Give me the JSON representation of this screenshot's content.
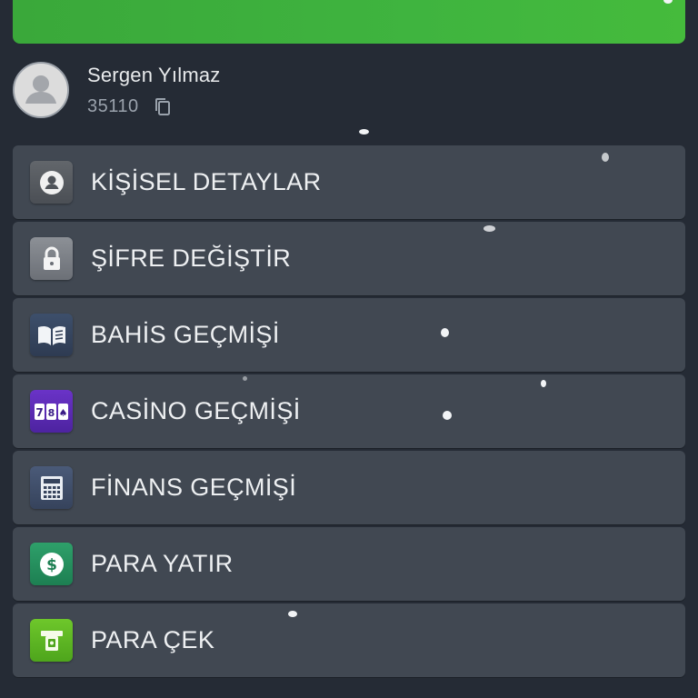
{
  "profile": {
    "name": "Sergen Yılmaz",
    "id": "35110"
  },
  "menu": {
    "items": [
      {
        "label": "KİŞİSEL DETAYLAR",
        "icon": "user-circle-icon"
      },
      {
        "label": "ŞİFRE DEĞİŞTİR",
        "icon": "lock-icon"
      },
      {
        "label": "BAHİS GEÇMİŞİ",
        "icon": "book-icon"
      },
      {
        "label": "CASİNO GEÇMİŞİ",
        "icon": "slot-machine-icon"
      },
      {
        "label": "FİNANS GEÇMİŞİ",
        "icon": "calculator-icon"
      },
      {
        "label": "PARA YATIR",
        "icon": "dollar-icon"
      },
      {
        "label": "PARA ÇEK",
        "icon": "atm-icon"
      }
    ]
  },
  "colors": {
    "background": "#252b35",
    "card": "#414852",
    "accent_green": "#3fb43f",
    "text": "#eef0f2",
    "muted_text": "#9aa2ac"
  }
}
